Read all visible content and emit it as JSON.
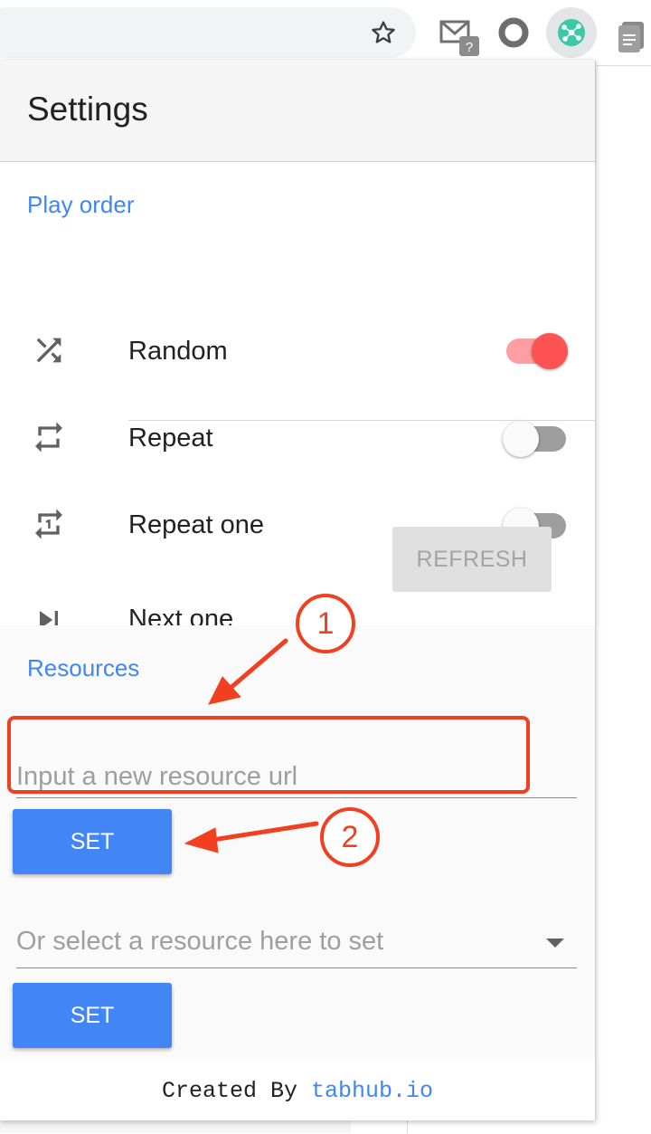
{
  "popup": {
    "title": "Settings",
    "play_order": {
      "title": "Play order",
      "items": [
        {
          "label": "Random",
          "icon": "shuffle-icon",
          "enabled": true
        },
        {
          "label": "Repeat",
          "icon": "repeat-icon",
          "enabled": false
        },
        {
          "label": "Repeat one",
          "icon": "repeat-one-icon",
          "enabled": false
        },
        {
          "label": "Next one",
          "icon": "skip-next-icon",
          "button_label": "REFRESH"
        }
      ]
    },
    "resources": {
      "title": "Resources",
      "url_placeholder": "Input a new resource url",
      "set_label": "SET",
      "select_placeholder": "Or select a resource here to set",
      "set_label_2": "SET"
    },
    "footer": {
      "prefix": "Created By ",
      "link": "tabhub.io"
    }
  },
  "annotations": {
    "callout_1": "1",
    "callout_2": "2"
  },
  "colors": {
    "accent": "#4285f4",
    "toggle_on": "#ff5252",
    "annotation": "#f0401f"
  }
}
